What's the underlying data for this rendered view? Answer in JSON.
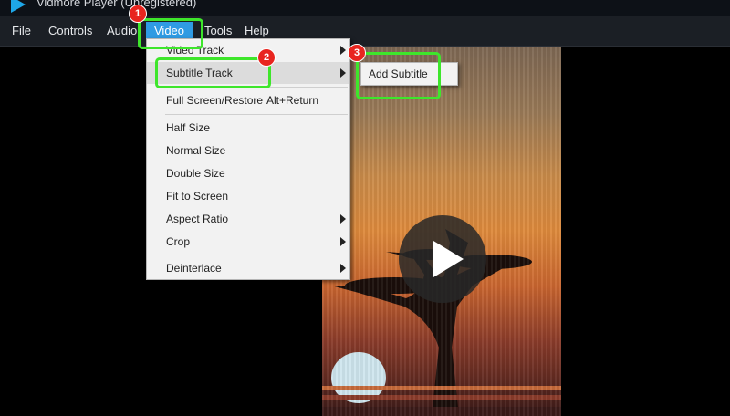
{
  "window": {
    "title": "Vidmore Player (Unregistered)"
  },
  "menubar": {
    "items": [
      {
        "label": "File"
      },
      {
        "label": "Controls"
      },
      {
        "label": "Audio"
      },
      {
        "label": "Video"
      },
      {
        "label": "Tools"
      },
      {
        "label": "Help"
      }
    ]
  },
  "video_menu": {
    "items": [
      {
        "label": "Video Track",
        "submenu": true
      },
      {
        "label": "Subtitle Track",
        "submenu": true,
        "highlighted": true
      },
      {
        "label": "Full Screen/Restore",
        "shortcut": "Alt+Return"
      },
      {
        "label": "Half Size"
      },
      {
        "label": "Normal Size"
      },
      {
        "label": "Double Size"
      },
      {
        "label": "Fit to Screen"
      },
      {
        "label": "Aspect Ratio",
        "submenu": true
      },
      {
        "label": "Crop",
        "submenu": true
      },
      {
        "label": "Deinterlace",
        "submenu": true
      }
    ]
  },
  "subtitle_submenu": {
    "items": [
      {
        "label": "Add Subtitle"
      }
    ]
  },
  "annotations": {
    "steps": [
      "1",
      "2",
      "3"
    ],
    "highlight_color": "#3ee62b",
    "badge_color": "#e8251f"
  },
  "player": {
    "play_icon": "play-icon",
    "accent": "#2f9be3"
  }
}
